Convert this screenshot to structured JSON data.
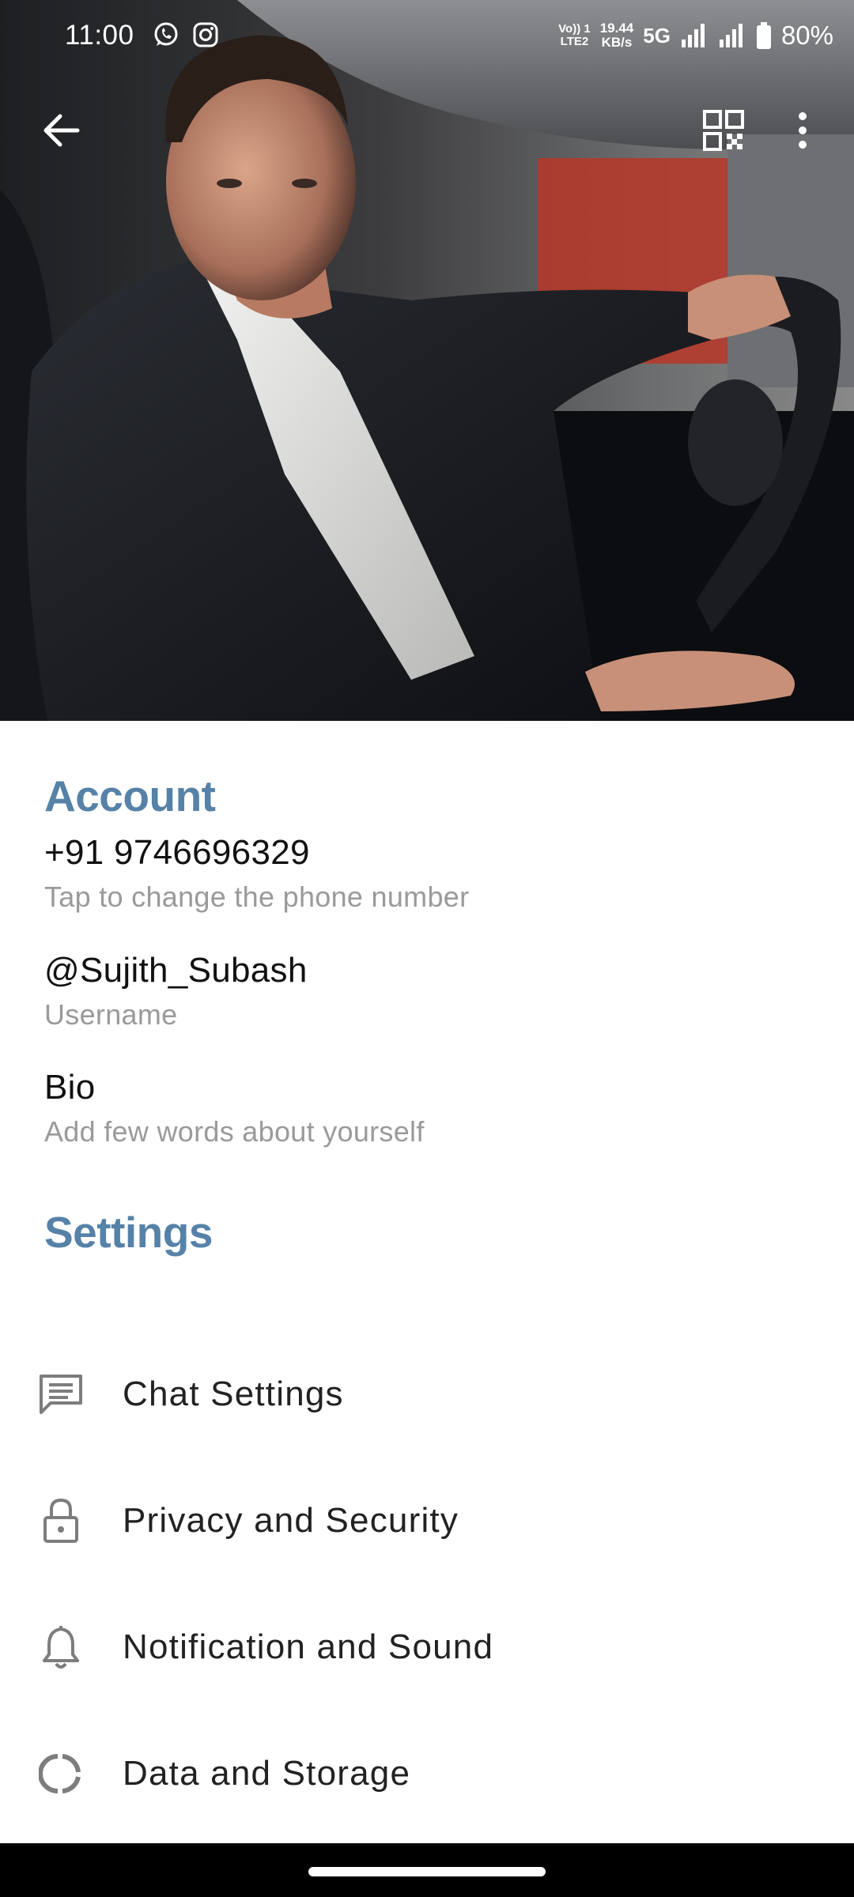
{
  "status_bar": {
    "time": "11:00",
    "app_icons": [
      "whatsapp-icon",
      "instagram-icon"
    ],
    "net_label_top": "Vo)) 1",
    "net_label_bottom": "LTE2",
    "speed_value": "19.44",
    "speed_unit": "KB/s",
    "network": "5G",
    "battery": "80%"
  },
  "header": {
    "back_icon": "arrow-left-icon",
    "qr_icon": "qr-code-icon",
    "menu_icon": "more-vertical-icon",
    "photo_description_icon": "profile-photo"
  },
  "account": {
    "title": "Account",
    "phone": "+91 9746696329",
    "phone_caption": "Tap to change the phone number",
    "username": "@Sujith_Subash",
    "username_caption": "Username",
    "bio": "Bio",
    "bio_caption": "Add few words about yourself"
  },
  "settings": {
    "title": "Settings",
    "items": [
      {
        "label": "Chat Settings",
        "icon": "chat-icon"
      },
      {
        "label": "Privacy and Security",
        "icon": "lock-icon"
      },
      {
        "label": "Notification and Sound",
        "icon": "bell-icon"
      },
      {
        "label": "Data and Storage",
        "icon": "storage-pie-icon"
      }
    ]
  },
  "colors": {
    "section_title": "#5682a8",
    "caption": "#9a9a9a",
    "text": "#111111"
  }
}
